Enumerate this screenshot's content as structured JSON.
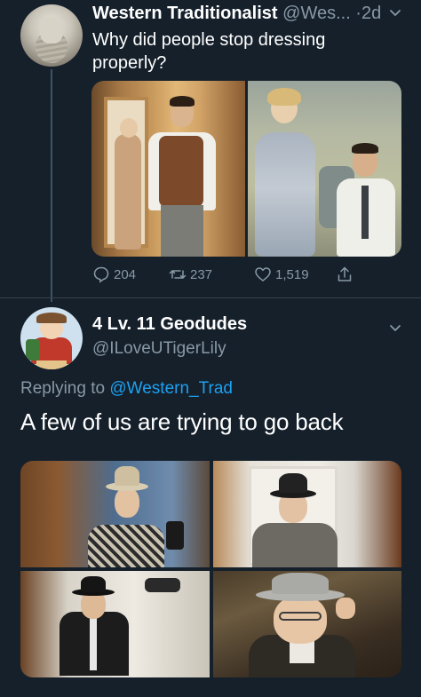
{
  "tweet1": {
    "display_name": "Western Traditionalist",
    "handle_time": "@Wes... ·2d",
    "text": "Why did people stop dressing properly?",
    "actions": {
      "replies": "204",
      "retweets": "237",
      "likes": "1,519"
    },
    "icons": [
      "reply-icon",
      "retweet-icon",
      "like-icon",
      "share-icon",
      "chevron-down-icon"
    ]
  },
  "tweet2": {
    "display_name": "4 Lv. 11 Geodudes",
    "handle": "@ILoveUTigerLily",
    "replying_prefix": "Replying to ",
    "replying_mention": "@Western_Trad",
    "text": "A few of us are trying to go back"
  },
  "colors": {
    "background": "#15202b",
    "secondary_text": "#8899a6",
    "link": "#1da1f2",
    "divider": "#38444d"
  }
}
